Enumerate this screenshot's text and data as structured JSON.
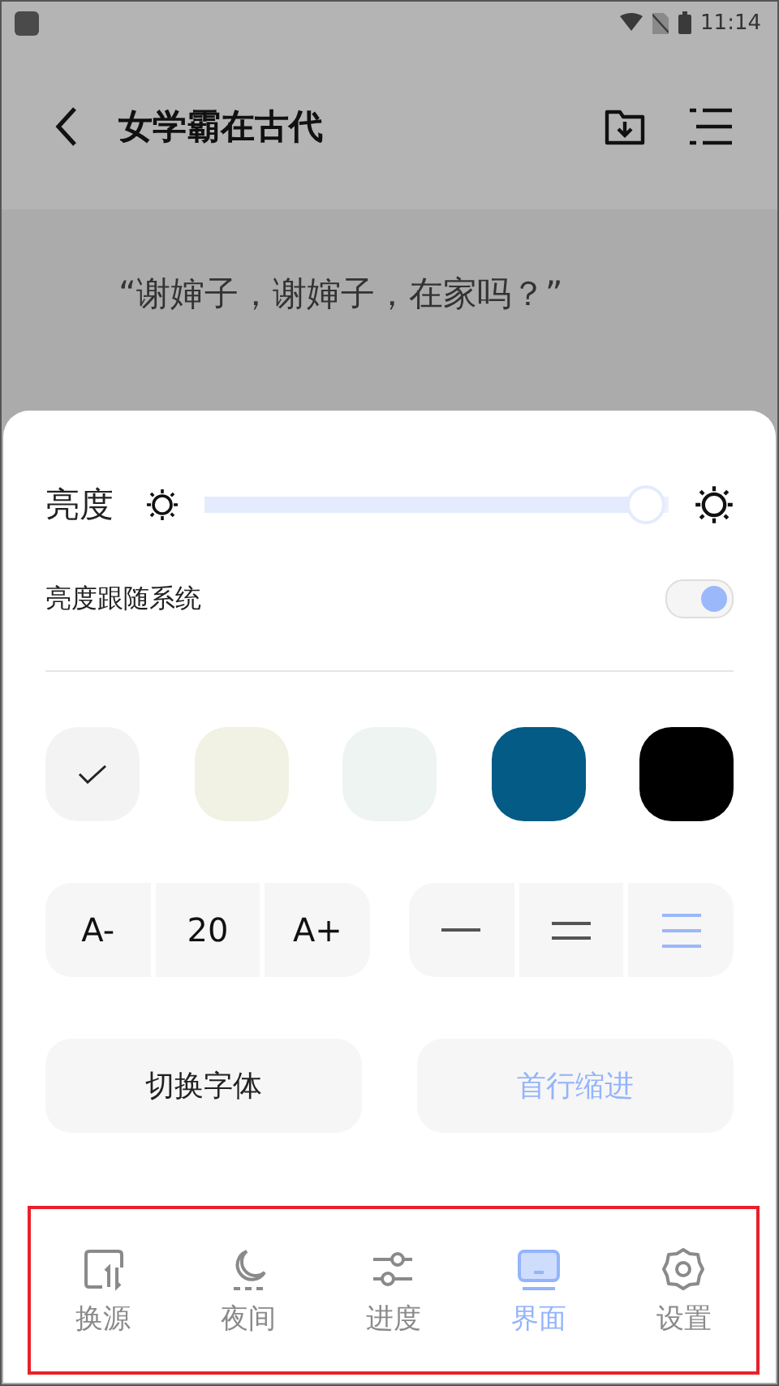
{
  "status_bar": {
    "time": "11:14"
  },
  "top_bar": {
    "title": "女学霸在古代"
  },
  "reader": {
    "paragraph": "“谢婶子，谢婶子，在家吗？”"
  },
  "settings_sheet": {
    "brightness": {
      "label": "亮度",
      "level": 0.95
    },
    "follow_system": {
      "label": "亮度跟随系统",
      "on": true
    },
    "themes": [
      {
        "color": "#f3f3f3",
        "selected": true
      },
      {
        "color": "#f1f1e4",
        "selected": false
      },
      {
        "color": "#eef4f1",
        "selected": false
      },
      {
        "color": "#035b86",
        "selected": false
      },
      {
        "color": "#000000",
        "selected": false
      }
    ],
    "font_size": {
      "decrease": "A-",
      "value": "20",
      "increase": "A+"
    },
    "line_spacing": [
      {
        "kind": "single",
        "selected": false
      },
      {
        "kind": "double",
        "selected": false
      },
      {
        "kind": "triple",
        "selected": true
      }
    ],
    "buttons": [
      {
        "label": "切换字体",
        "selected": false
      },
      {
        "label": "首行缩进",
        "selected": true
      }
    ]
  },
  "bottom_nav": [
    {
      "kind": "source",
      "label": "换源",
      "selected": false
    },
    {
      "kind": "night",
      "label": "夜间",
      "selected": false
    },
    {
      "kind": "progress",
      "label": "进度",
      "selected": false
    },
    {
      "kind": "interface",
      "label": "界面",
      "selected": true
    },
    {
      "kind": "settings",
      "label": "设置",
      "selected": false
    }
  ]
}
